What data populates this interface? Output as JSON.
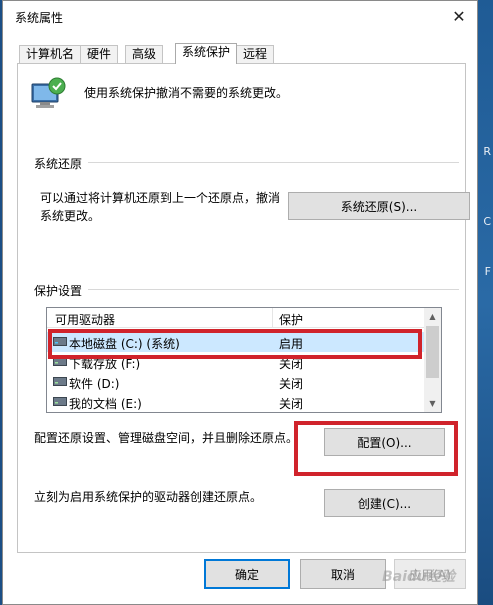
{
  "window": {
    "title": "系统属性"
  },
  "tabs": [
    {
      "label": "计算机名"
    },
    {
      "label": "硬件"
    },
    {
      "label": "高级"
    },
    {
      "label": "系统保护"
    },
    {
      "label": "远程"
    }
  ],
  "intro": {
    "text": "使用系统保护撤消不需要的系统更改。",
    "icon": "computer-shield-icon"
  },
  "restore": {
    "section": "系统还原",
    "text_line1": "可以通过将计算机还原到上一个还原点，撤消",
    "text_line2": "系统更改。",
    "button": "系统还原(S)..."
  },
  "protection": {
    "section": "保护设置",
    "columns": {
      "drive": "可用驱动器",
      "status": "保护"
    },
    "drives": [
      {
        "name": "本地磁盘 (C:) (系统)",
        "status": "启用",
        "selected": true
      },
      {
        "name": "下载存放 (F:)",
        "status": "关闭"
      },
      {
        "name": "软件 (D:)",
        "status": "关闭"
      },
      {
        "name": "我的文档 (E:)",
        "status": "关闭"
      }
    ],
    "configure_text": "配置还原设置、管理磁盘空间，并且删除还原点。",
    "configure_button": "配置(O)...",
    "create_text": "立刻为启用系统保护的驱动器创建还原点。",
    "create_button": "创建(C)..."
  },
  "footer": {
    "ok": "确定",
    "cancel": "取消",
    "apply": "应用(A)"
  },
  "watermark": "Baidu经验",
  "colors": {
    "highlight": "#d0232b",
    "selection": "#cce8ff",
    "accent": "#0078d7"
  }
}
